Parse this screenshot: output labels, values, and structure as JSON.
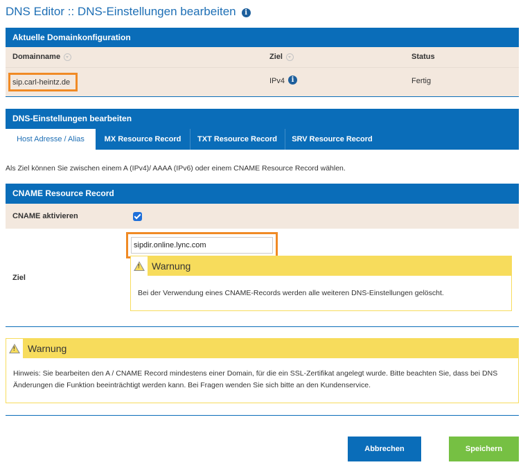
{
  "page": {
    "title": "DNS Editor :: DNS-Einstellungen bearbeiten",
    "info_symbol": "i"
  },
  "current_config": {
    "header": "Aktuelle Domainkonfiguration",
    "columns": [
      "Domainname",
      "Ziel",
      "Status"
    ],
    "row": {
      "domain": "sip.carl-heintz.de",
      "target": "IPv4",
      "status": "Fertig"
    }
  },
  "edit_section": {
    "header": "DNS-Einstellungen bearbeiten",
    "tabs": [
      {
        "label": "Host Adresse / Alias",
        "active": true
      },
      {
        "label": "MX Resource Record",
        "active": false
      },
      {
        "label": "TXT Resource Record",
        "active": false
      },
      {
        "label": "SRV Resource Record",
        "active": false
      }
    ],
    "help_text": "Als Ziel können Sie zwischen einem A (IPv4)/ AAAA (IPv6) oder einem CNAME Resource Record wählen."
  },
  "cname": {
    "header": "CNAME Resource Record",
    "activate_label": "CNAME aktivieren",
    "activated": true,
    "target_label": "Ziel",
    "target_value": "sipdir.online.lync.com",
    "warning": {
      "title": "Warnung",
      "text": "Bei der Verwendung eines CNAME-Records werden alle weiteren DNS-Einstellungen gelöscht."
    }
  },
  "ssl_warning": {
    "title": "Warnung",
    "text": "Hinweis: Sie bearbeiten den A / CNAME Record mindestens einer Domain, für die ein SSL-Zertifikat angelegt wurde. Bitte beachten Sie, dass bei DNS Änderungen die Funktion beeinträchtigt werden kann. Bei Fragen wenden Sie sich bitte an den Kundenservice."
  },
  "buttons": {
    "cancel": "Abbrechen",
    "save": "Speichern"
  },
  "colors": {
    "primary_blue": "#0a6db9",
    "title_blue": "#1e6fb5",
    "highlight_orange": "#f08a25",
    "warning_yellow": "#f7dc5c",
    "row_beige": "#f3e8de",
    "save_green": "#76c043"
  }
}
